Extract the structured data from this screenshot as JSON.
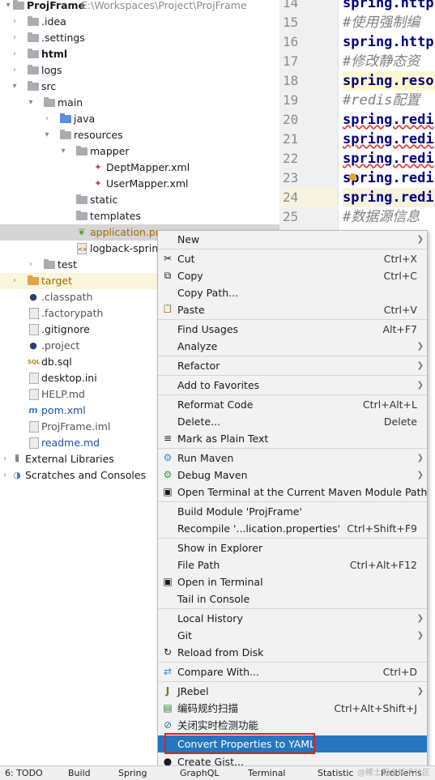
{
  "tree": {
    "root": {
      "name": "ProjFrame",
      "path": "E:\\Workspaces\\Project\\ProjFrame"
    },
    "items": [
      {
        "label": ".idea"
      },
      {
        "label": ".settings"
      },
      {
        "label": "html"
      },
      {
        "label": "logs"
      },
      {
        "label": "src"
      },
      {
        "label": "main"
      },
      {
        "label": "java"
      },
      {
        "label": "resources"
      },
      {
        "label": "mapper"
      },
      {
        "label": "DeptMapper.xml"
      },
      {
        "label": "UserMapper.xml"
      },
      {
        "label": "static"
      },
      {
        "label": "templates"
      },
      {
        "label": "application.pro"
      },
      {
        "label": "logback-spring"
      },
      {
        "label": "test"
      },
      {
        "label": "target"
      },
      {
        "label": ".classpath"
      },
      {
        "label": ".factorypath"
      },
      {
        "label": ".gitignore"
      },
      {
        "label": ".project"
      },
      {
        "label": "db.sql"
      },
      {
        "label": "desktop.ini"
      },
      {
        "label": "HELP.md"
      },
      {
        "label": "pom.xml"
      },
      {
        "label": "ProjFrame.iml"
      },
      {
        "label": "readme.md"
      },
      {
        "label": "External Libraries"
      },
      {
        "label": "Scratches and Consoles"
      }
    ]
  },
  "editor": {
    "lines": [
      {
        "num": "14",
        "text": "spring.http"
      },
      {
        "num": "15",
        "text": "#使用强制编"
      },
      {
        "num": "16",
        "text": "spring.http"
      },
      {
        "num": "17",
        "text": "#修改静态资"
      },
      {
        "num": "18",
        "text": "spring.reso"
      },
      {
        "num": "19",
        "text": "#redis配置"
      },
      {
        "num": "20",
        "text": "spring.redi"
      },
      {
        "num": "21",
        "text": "spring.redi"
      },
      {
        "num": "22",
        "text": "spring.redi"
      },
      {
        "num": "23",
        "text": "spring.redi"
      },
      {
        "num": "24",
        "text": "spring.redi"
      },
      {
        "num": "25",
        "text": "#数据源信息"
      }
    ]
  },
  "menu": {
    "items": [
      {
        "label": "New",
        "shortcut": "",
        "icon": ""
      },
      {
        "label": "Cut",
        "shortcut": "Ctrl+X",
        "icon": "✂"
      },
      {
        "label": "Copy",
        "shortcut": "Ctrl+C",
        "icon": "⧉"
      },
      {
        "label": "Copy Path...",
        "shortcut": "",
        "icon": ""
      },
      {
        "label": "Paste",
        "shortcut": "Ctrl+V",
        "icon": "📋"
      },
      {
        "label": "Find Usages",
        "shortcut": "Alt+F7",
        "icon": ""
      },
      {
        "label": "Analyze",
        "shortcut": "",
        "icon": ""
      },
      {
        "label": "Refactor",
        "shortcut": "",
        "icon": ""
      },
      {
        "label": "Add to Favorites",
        "shortcut": "",
        "icon": ""
      },
      {
        "label": "Reformat Code",
        "shortcut": "Ctrl+Alt+L",
        "icon": ""
      },
      {
        "label": "Delete...",
        "shortcut": "Delete",
        "icon": ""
      },
      {
        "label": "Mark as Plain Text",
        "shortcut": "",
        "icon": "≡"
      },
      {
        "label": "Run Maven",
        "shortcut": "",
        "icon": "⚙"
      },
      {
        "label": "Debug Maven",
        "shortcut": "",
        "icon": "⚙"
      },
      {
        "label": "Open Terminal at the Current Maven Module Path",
        "shortcut": "",
        "icon": "▣"
      },
      {
        "label": "Build Module 'ProjFrame'",
        "shortcut": "",
        "icon": ""
      },
      {
        "label": "Recompile '...lication.properties'",
        "shortcut": "Ctrl+Shift+F9",
        "icon": ""
      },
      {
        "label": "Show in Explorer",
        "shortcut": "",
        "icon": ""
      },
      {
        "label": "File Path",
        "shortcut": "Ctrl+Alt+F12",
        "icon": ""
      },
      {
        "label": "Open in Terminal",
        "shortcut": "",
        "icon": "▣"
      },
      {
        "label": "Tail in Console",
        "shortcut": "",
        "icon": ""
      },
      {
        "label": "Local History",
        "shortcut": "",
        "icon": ""
      },
      {
        "label": "Git",
        "shortcut": "",
        "icon": ""
      },
      {
        "label": "Reload from Disk",
        "shortcut": "",
        "icon": "↻"
      },
      {
        "label": "Compare With...",
        "shortcut": "Ctrl+D",
        "icon": "⇄"
      },
      {
        "label": "JRebel",
        "shortcut": "",
        "icon": "J"
      },
      {
        "label": "编码规约扫描",
        "shortcut": "Ctrl+Alt+Shift+J",
        "icon": "▤"
      },
      {
        "label": "关闭实时检测功能",
        "shortcut": "",
        "icon": "⊘"
      },
      {
        "label": "Convert Properties to YAML",
        "shortcut": "",
        "icon": ""
      },
      {
        "label": "Create Gist...",
        "shortcut": "",
        "icon": "●"
      }
    ]
  },
  "statusbar": {
    "items": [
      {
        "label": "6: TODO"
      },
      {
        "label": "Build"
      },
      {
        "label": "Spring"
      },
      {
        "label": "GraphQL"
      },
      {
        "label": "Terminal"
      },
      {
        "label": "Statistic"
      },
      {
        "label": "Problems"
      }
    ],
    "watermark": "@稀土掘金技术社区"
  },
  "colors": {
    "accent": "#2675bf",
    "highlight_box": "#e02020"
  }
}
